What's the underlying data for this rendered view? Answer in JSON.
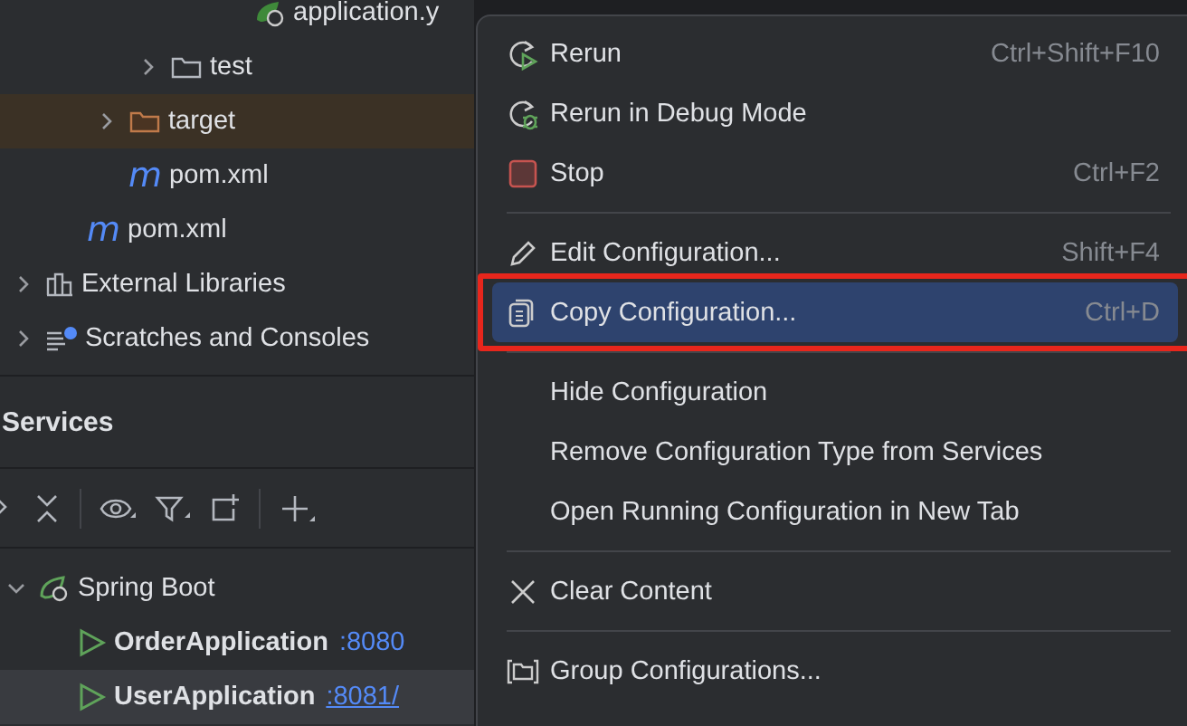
{
  "project_tree": {
    "items": [
      {
        "children": [
          {
            "children": [
              {
                "children": [
                  {
                    "children": [
                      {
                        "children": [
                          {
                            "label": "application.y",
                            "kind": "spring-config"
                          }
                        ]
                      }
                    ]
                  },
                  {
                    "label": "test",
                    "kind": "folder",
                    "expanded": false,
                    "excluded": false
                  }
                ]
              },
              {
                "label": "target",
                "kind": "folder",
                "expanded": false,
                "excluded": true
              },
              {
                "label": "pom.xml",
                "kind": "maven",
                "glyph": "m"
              }
            ]
          },
          {
            "label": "pom.xml",
            "kind": "maven",
            "glyph": "m"
          }
        ]
      },
      {
        "label": "External Libraries",
        "kind": "library",
        "expanded": false
      },
      {
        "label": "Scratches and Consoles",
        "kind": "scratches",
        "expanded": false
      }
    ]
  },
  "services": {
    "title": "Services",
    "tree": [
      {
        "label": "Spring Boot",
        "kind": "spring",
        "expanded": true,
        "selected": false,
        "children": [
          {
            "label": "OrderApplication",
            "port": ":8080",
            "kind": "app",
            "selected": false
          },
          {
            "label": "UserApplication",
            "port": ":8081/",
            "kind": "app",
            "selected": true
          }
        ]
      }
    ]
  },
  "context_menu": {
    "groups": [
      [
        {
          "label": "Rerun",
          "shortcut": "Ctrl+Shift+F10",
          "kind": "rerun",
          "selected": false,
          "outlined": false
        },
        {
          "label": "Rerun in Debug Mode",
          "kind": "debug",
          "selected": false,
          "outlined": false
        },
        {
          "label": "Stop",
          "shortcut": "Ctrl+F2",
          "kind": "stop",
          "selected": false,
          "outlined": false
        }
      ],
      [
        {
          "label": "Edit Configuration...",
          "shortcut": "Shift+F4",
          "kind": "edit",
          "selected": false,
          "outlined": false
        },
        {
          "label": "Copy Configuration...",
          "shortcut": "Ctrl+D",
          "kind": "copy",
          "selected": true,
          "outlined": true
        }
      ],
      [
        {
          "label": "Hide Configuration",
          "selected": false,
          "outlined": false
        },
        {
          "label": "Remove Configuration Type from Services",
          "selected": false,
          "outlined": false
        },
        {
          "label": "Open Running Configuration in New Tab",
          "selected": false,
          "outlined": false
        }
      ],
      [
        {
          "label": "Clear Content",
          "kind": "clear",
          "selected": false,
          "outlined": false
        }
      ],
      [
        {
          "label": "Group Configurations...",
          "kind": "group",
          "selected": false,
          "outlined": false
        }
      ]
    ]
  }
}
